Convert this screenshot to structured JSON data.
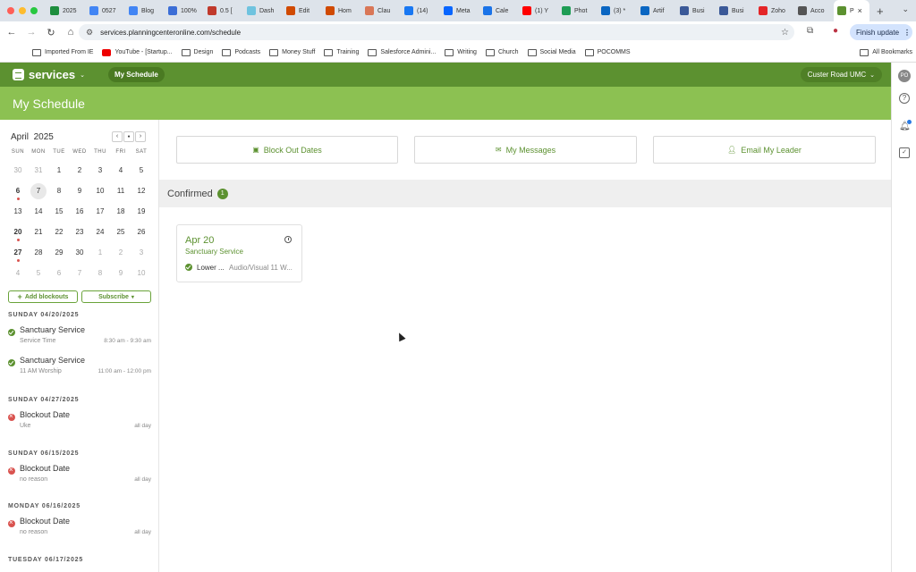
{
  "browser": {
    "tabs": [
      {
        "label": "2025",
        "color": "#1e8e3e"
      },
      {
        "label": "0527",
        "color": "#4285f4"
      },
      {
        "label": "Blog",
        "color": "#4285f4"
      },
      {
        "label": "100%",
        "color": "#3c6ed6"
      },
      {
        "label": "0.5 [",
        "color": "#c0392b"
      },
      {
        "label": "Dash",
        "color": "#6fc3df"
      },
      {
        "label": "Edit",
        "color": "#d04a02"
      },
      {
        "label": "Hom",
        "color": "#d04a02"
      },
      {
        "label": "Clau",
        "color": "#d97757"
      },
      {
        "label": "(14)",
        "color": "#1877f2"
      },
      {
        "label": "Meta",
        "color": "#0866ff"
      },
      {
        "label": "Cale",
        "color": "#1a73e8"
      },
      {
        "label": "(1) Y",
        "color": "#ff0000"
      },
      {
        "label": "Phot",
        "color": "#1f9d55"
      },
      {
        "label": "(3) *",
        "color": "#0a66c2"
      },
      {
        "label": "Artif",
        "color": "#0a66c2"
      },
      {
        "label": "Busi",
        "color": "#3b5998"
      },
      {
        "label": "Busi",
        "color": "#3b5998"
      },
      {
        "label": "Zoho",
        "color": "#e42527"
      },
      {
        "label": "Acco",
        "color": "#555555"
      },
      {
        "label": "P",
        "color": "#5c9130",
        "active": true
      }
    ],
    "url": "services.planningcenteronline.com/schedule",
    "finish_update": "Finish update",
    "bookmarks": [
      "Imported From IE",
      "YouTube - [Startup...",
      "Design",
      "Podcasts",
      "Money Stuff",
      "Training",
      "Salesforce Admini...",
      "Writing",
      "Church",
      "Social Media",
      "POCOMMS"
    ],
    "all_bookmarks": "All Bookmarks",
    "profile_initials": "PO"
  },
  "app": {
    "logo": "services",
    "nav_pill": "My Schedule",
    "org": "Custer Road UMC",
    "page_title": "My Schedule"
  },
  "calendar": {
    "month": "April",
    "year": "2025",
    "weekdays": [
      "SUN",
      "MON",
      "TUE",
      "WED",
      "THU",
      "FRI",
      "SAT"
    ],
    "weeks": [
      [
        "30",
        "31",
        "1",
        "2",
        "3",
        "4",
        "5"
      ],
      [
        "6",
        "7",
        "8",
        "9",
        "10",
        "11",
        "12"
      ],
      [
        "13",
        "14",
        "15",
        "16",
        "17",
        "18",
        "19"
      ],
      [
        "20",
        "21",
        "22",
        "23",
        "24",
        "25",
        "26"
      ],
      [
        "27",
        "28",
        "29",
        "30",
        "1",
        "2",
        "3"
      ],
      [
        "4",
        "5",
        "6",
        "7",
        "8",
        "9",
        "10"
      ]
    ]
  },
  "sidebar": {
    "add_blockouts": "Add blockouts",
    "subscribe": "Subscribe",
    "groups": [
      {
        "heading": "SUNDAY 04/20/2025",
        "items": [
          {
            "title": "Sanctuary Service",
            "sub": "Service Time",
            "time": "8:30 am - 9:30 am",
            "status": "ok"
          },
          {
            "title": "Sanctuary Service",
            "sub": "11 AM Worship",
            "time": "11:00 am - 12:00 pm",
            "status": "ok"
          }
        ]
      },
      {
        "heading": "SUNDAY 04/27/2025",
        "items": [
          {
            "title": "Blockout Date",
            "sub": "Uke",
            "time": "all day",
            "status": "no"
          }
        ]
      },
      {
        "heading": "SUNDAY 06/15/2025",
        "items": [
          {
            "title": "Blockout Date",
            "sub": "no reason",
            "time": "all day",
            "status": "no"
          }
        ]
      },
      {
        "heading": "MONDAY 06/16/2025",
        "items": [
          {
            "title": "Blockout Date",
            "sub": "no reason",
            "time": "all day",
            "status": "no"
          }
        ]
      },
      {
        "heading": "TUESDAY 06/17/2025",
        "items": []
      }
    ]
  },
  "actions": {
    "block_out": "Block Out Dates",
    "messages": "My Messages",
    "email_leader": "Email My Leader"
  },
  "confirmed": {
    "label": "Confirmed",
    "count": "1",
    "card": {
      "date": "Apr 20",
      "service": "Sanctuary Service",
      "position": "Lower ...",
      "team": "Audio/Visual 11 W..."
    }
  }
}
